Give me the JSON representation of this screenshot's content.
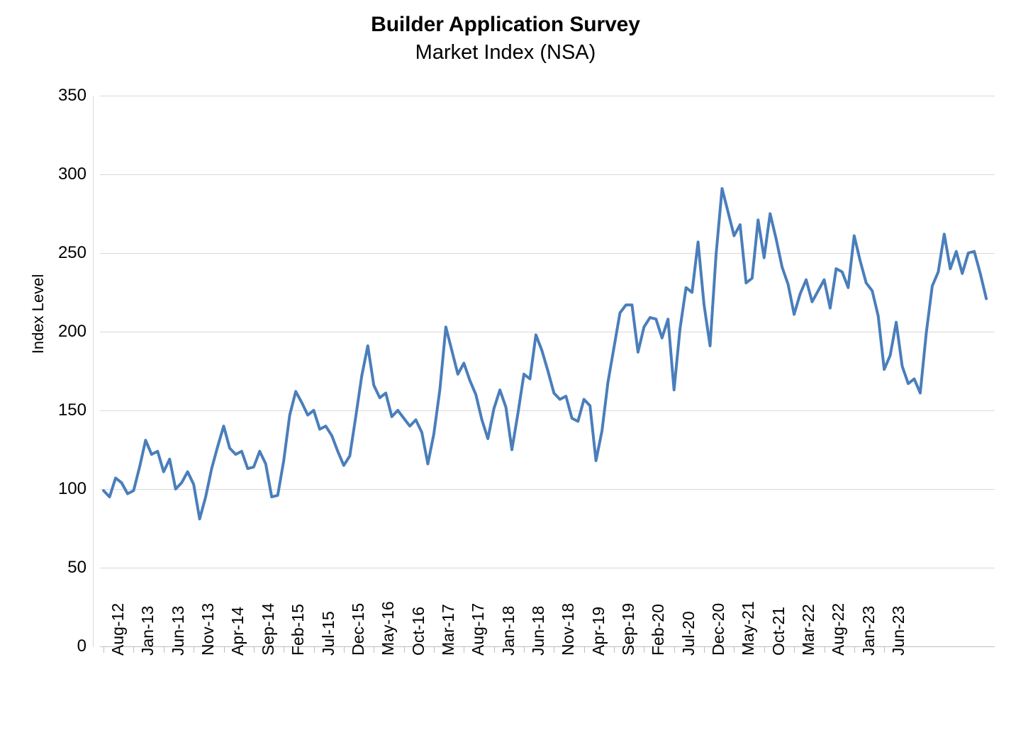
{
  "header": {
    "title": "Builder Application Survey",
    "subtitle": "Market Index (NSA)"
  },
  "axes": {
    "y_title": "Index Level",
    "x_title": ""
  },
  "chart_data": {
    "type": "line",
    "title": "Builder Application Survey",
    "subtitle": "Market Index (NSA)",
    "xlabel": "",
    "ylabel": "Index Level",
    "ylim": [
      0,
      350
    ],
    "y_ticks": [
      0,
      50,
      100,
      150,
      200,
      250,
      300,
      350
    ],
    "y_tick_labels": [
      "0",
      "50",
      "100",
      "150",
      "200",
      "250",
      "300",
      "350"
    ],
    "grid": true,
    "legend": "none",
    "line_color": "#4a7ebb",
    "line_width": 4,
    "x_tick_labels": [
      "Aug-12",
      "Jan-13",
      "Jun-13",
      "Nov-13",
      "Apr-14",
      "Sep-14",
      "Feb-15",
      "Jul-15",
      "Dec-15",
      "May-16",
      "Oct-16",
      "Mar-17",
      "Aug-17",
      "Jan-18",
      "Jun-18",
      "Nov-18",
      "Apr-19",
      "Sep-19",
      "Feb-20",
      "Jul-20",
      "Dec-20",
      "May-21",
      "Oct-21",
      "Mar-22",
      "Aug-22",
      "Jan-23",
      "Jun-23"
    ],
    "x_tick_interval_months": 5,
    "x": [
      "Aug-12",
      "Sep-12",
      "Oct-12",
      "Nov-12",
      "Dec-12",
      "Jan-13",
      "Feb-13",
      "Mar-13",
      "Apr-13",
      "May-13",
      "Jun-13",
      "Jul-13",
      "Aug-13",
      "Sep-13",
      "Oct-13",
      "Nov-13",
      "Dec-13",
      "Jan-14",
      "Feb-14",
      "Mar-14",
      "Apr-14",
      "May-14",
      "Jun-14",
      "Jul-14",
      "Aug-14",
      "Sep-14",
      "Oct-14",
      "Nov-14",
      "Dec-14",
      "Jan-15",
      "Feb-15",
      "Mar-15",
      "Apr-15",
      "May-15",
      "Jun-15",
      "Jul-15",
      "Aug-15",
      "Sep-15",
      "Oct-15",
      "Nov-15",
      "Dec-15",
      "Jan-16",
      "Feb-16",
      "Mar-16",
      "Apr-16",
      "May-16",
      "Jun-16",
      "Jul-16",
      "Aug-16",
      "Sep-16",
      "Oct-16",
      "Nov-16",
      "Dec-16",
      "Jan-17",
      "Feb-17",
      "Mar-17",
      "Apr-17",
      "May-17",
      "Jun-17",
      "Jul-17",
      "Aug-17",
      "Sep-17",
      "Oct-17",
      "Nov-17",
      "Dec-17",
      "Jan-18",
      "Feb-18",
      "Mar-18",
      "Apr-18",
      "May-18",
      "Jun-18",
      "Jul-18",
      "Aug-18",
      "Sep-18",
      "Oct-18",
      "Nov-18",
      "Dec-18",
      "Jan-19",
      "Feb-19",
      "Mar-19",
      "Apr-19",
      "May-19",
      "Jun-19",
      "Jul-19",
      "Aug-19",
      "Sep-19",
      "Oct-19",
      "Nov-19",
      "Dec-19",
      "Jan-20",
      "Feb-20",
      "Mar-20",
      "Apr-20",
      "May-20",
      "Jun-20",
      "Jul-20",
      "Aug-20",
      "Sep-20",
      "Oct-20",
      "Nov-20",
      "Dec-20",
      "Jan-21",
      "Feb-21",
      "Mar-21",
      "Apr-21",
      "May-21",
      "Jun-21",
      "Jul-21",
      "Aug-21",
      "Sep-21",
      "Oct-21",
      "Nov-21",
      "Dec-21",
      "Jan-22",
      "Feb-22",
      "Mar-22",
      "Apr-22",
      "May-22",
      "Jun-22",
      "Jul-22",
      "Aug-22",
      "Sep-22",
      "Oct-22",
      "Nov-22",
      "Dec-22",
      "Jan-23",
      "Feb-23",
      "Mar-23",
      "Apr-23",
      "May-23",
      "Jun-23",
      "Jul-23",
      "Aug-23"
    ],
    "values": [
      99,
      95,
      107,
      104,
      97,
      99,
      114,
      131,
      122,
      124,
      111,
      119,
      100,
      104,
      111,
      103,
      81,
      95,
      113,
      127,
      140,
      126,
      122,
      124,
      113,
      114,
      124,
      116,
      95,
      96,
      118,
      147,
      162,
      155,
      147,
      150,
      138,
      140,
      134,
      124,
      115,
      121,
      146,
      172,
      191,
      166,
      158,
      161,
      146,
      150,
      145,
      140,
      144,
      136,
      116,
      135,
      163,
      203,
      188,
      173,
      180,
      169,
      160,
      144,
      132,
      151,
      163,
      152,
      125,
      148,
      173,
      170,
      198,
      188,
      175,
      161,
      157,
      159,
      145,
      143,
      157,
      153,
      118,
      137,
      168,
      190,
      212,
      217,
      217,
      187,
      203,
      209,
      208,
      196,
      208,
      163,
      202,
      228,
      225,
      257,
      217,
      191,
      249,
      291,
      276,
      261,
      268,
      231,
      234,
      271,
      247,
      275,
      259,
      241,
      230,
      211,
      224,
      233,
      219,
      226,
      233,
      215,
      240,
      238,
      228,
      261,
      245,
      231,
      226,
      210,
      176,
      185,
      206,
      178,
      167,
      170,
      161,
      199,
      229,
      238,
      262,
      240,
      251,
      237,
      250,
      251,
      237,
      221
    ]
  }
}
